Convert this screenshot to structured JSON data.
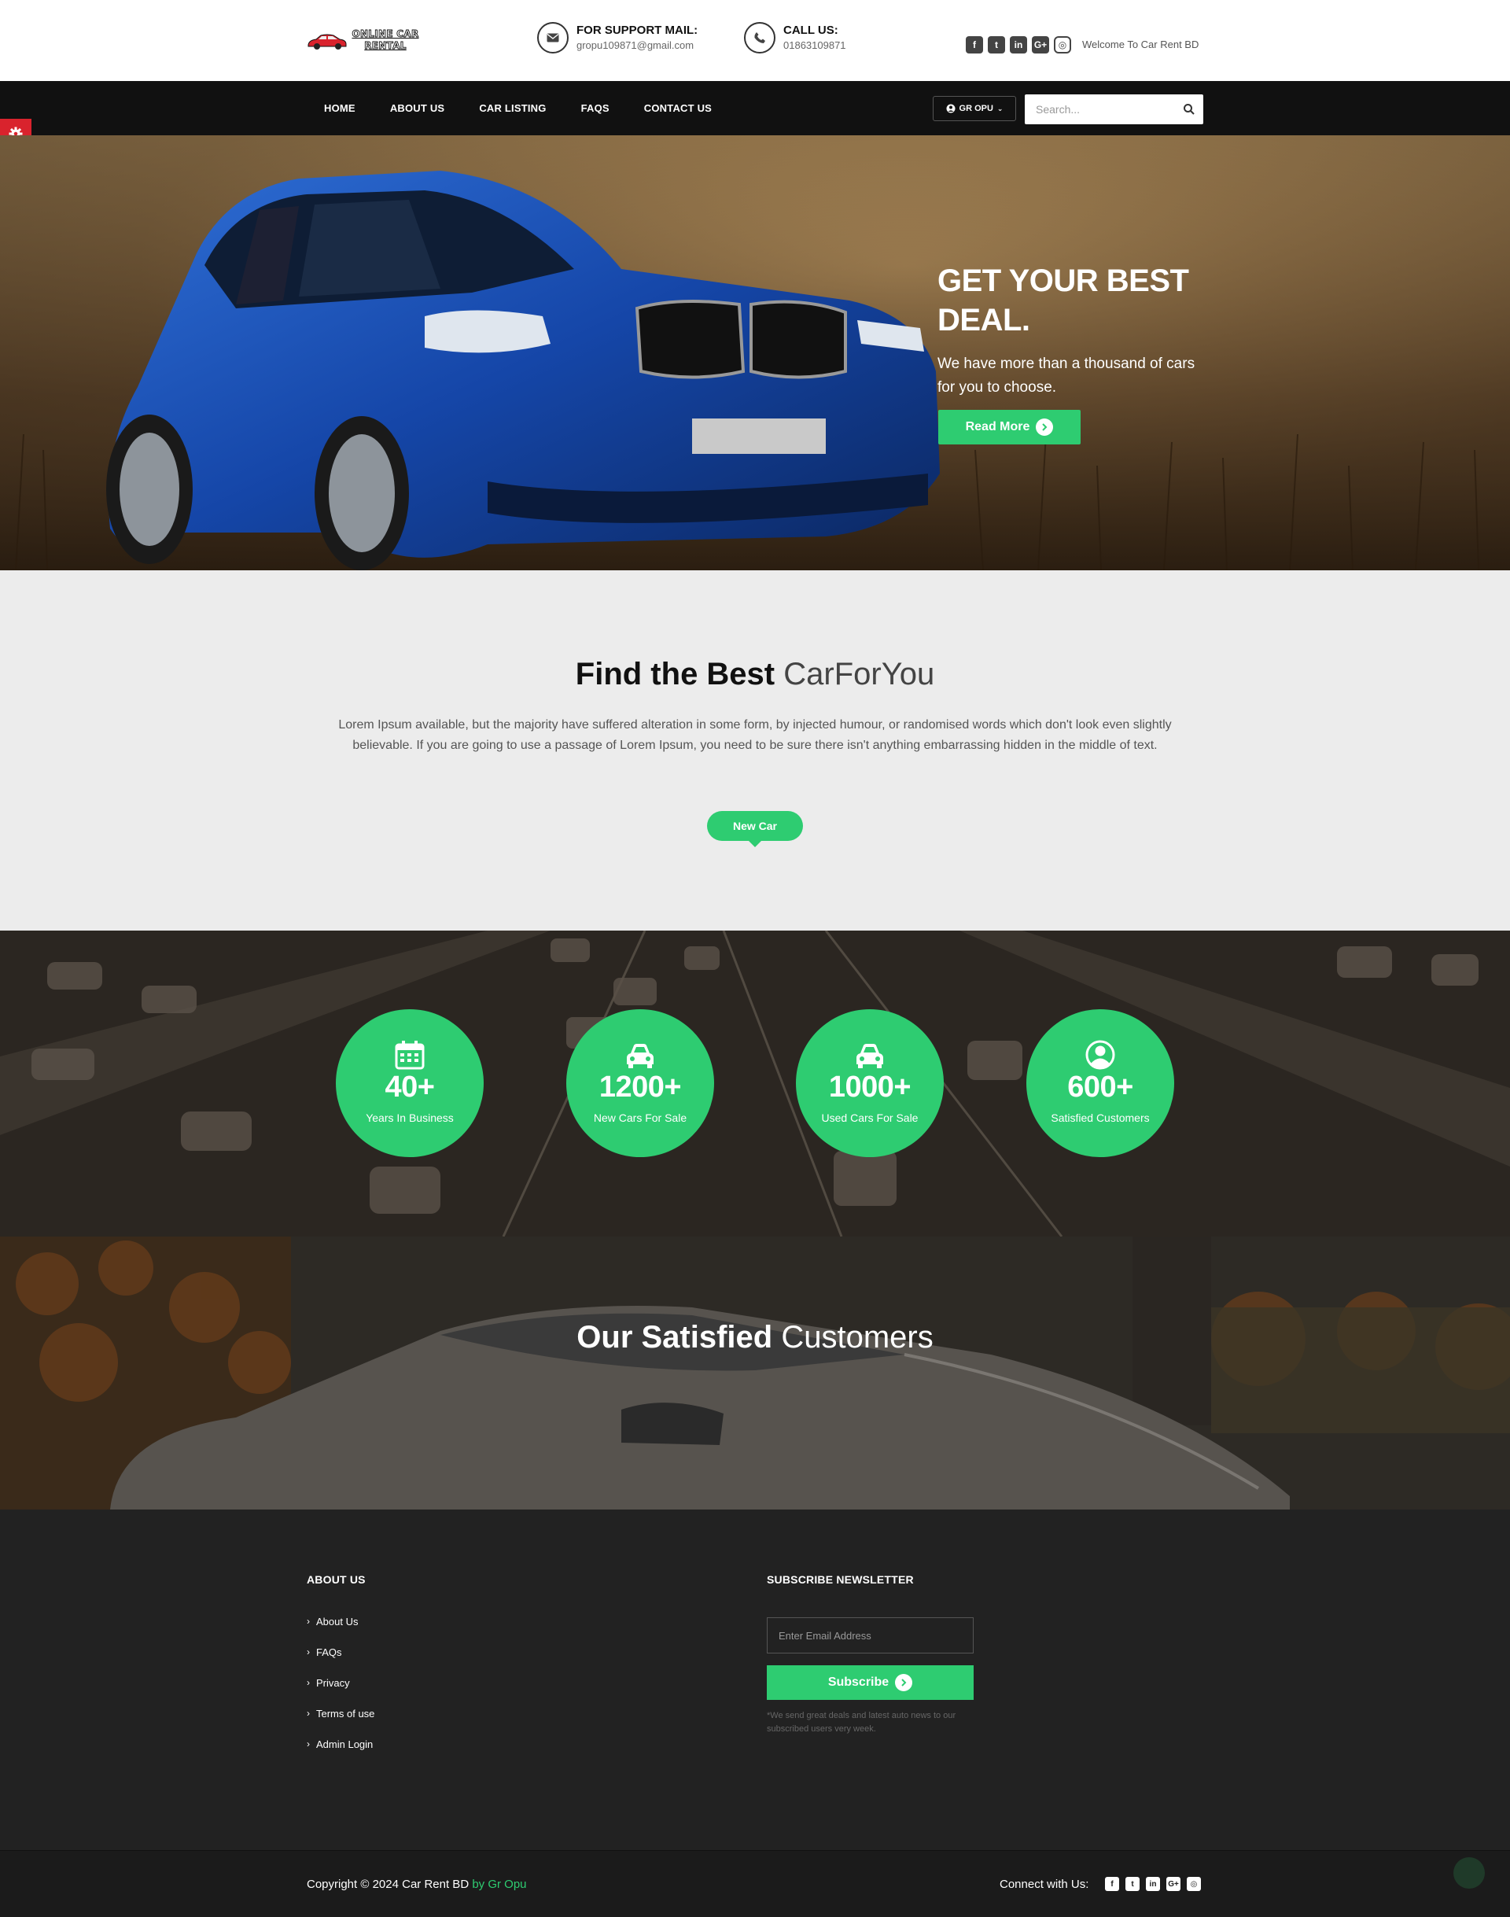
{
  "brand": {
    "logo_text": "ONLINE CAR RENTAL",
    "accent": "#2ecc71"
  },
  "header": {
    "support_label": "FOR SUPPORT MAIL:",
    "support_email": "gropu109871@gmail.com",
    "call_label": "CALL US:",
    "call_number": "01863109871",
    "welcome": "Welcome To Car Rent BD",
    "social_icons": [
      "facebook-icon",
      "twitter-icon",
      "linkedin-icon",
      "google-plus-icon",
      "instagram-icon"
    ]
  },
  "nav": {
    "items": [
      "HOME",
      "ABOUT US",
      "CAR LISTING",
      "FAQS",
      "CONTACT US"
    ],
    "user_label": "GR OPU",
    "search_placeholder": "Search..."
  },
  "hero": {
    "title": "GET YOUR BEST DEAL.",
    "subtitle": "We have more than a thousand of cars for you to choose.",
    "button": "Read More"
  },
  "find": {
    "title_bold": "Find the Best",
    "title_light": "CarForYou",
    "text": "Lorem Ipsum available, but the majority have suffered alteration in some form, by injected humour, or randomised words which don't look even slightly believable. If you are going to use a passage of Lorem Ipsum, you need to be sure there isn't anything embarrassing hidden in the middle of text.",
    "tab": "New Car"
  },
  "stats": [
    {
      "icon": "calendar-icon",
      "number": "40+",
      "label": "Years In Business"
    },
    {
      "icon": "car-icon",
      "number": "1200+",
      "label": "New Cars For Sale"
    },
    {
      "icon": "car-icon",
      "number": "1000+",
      "label": "Used Cars For Sale"
    },
    {
      "icon": "user-circle-icon",
      "number": "600+",
      "label": "Satisfied Customers"
    }
  ],
  "customers": {
    "title_bold": "Our Satisfied",
    "title_light": "Customers"
  },
  "footer": {
    "about_heading": "ABOUT US",
    "links": [
      "About Us",
      "FAQs",
      "Privacy",
      "Terms of use",
      "Admin Login"
    ],
    "newsletter_heading": "SUBSCRIBE NEWSLETTER",
    "email_placeholder": "Enter Email Address",
    "subscribe": "Subscribe",
    "note": "*We send great deals and latest auto news to our subscribed users very week.",
    "copyright": "Copyright © 2024 Car Rent BD",
    "by": "by Gr Opu",
    "connect": "Connect with Us:"
  }
}
